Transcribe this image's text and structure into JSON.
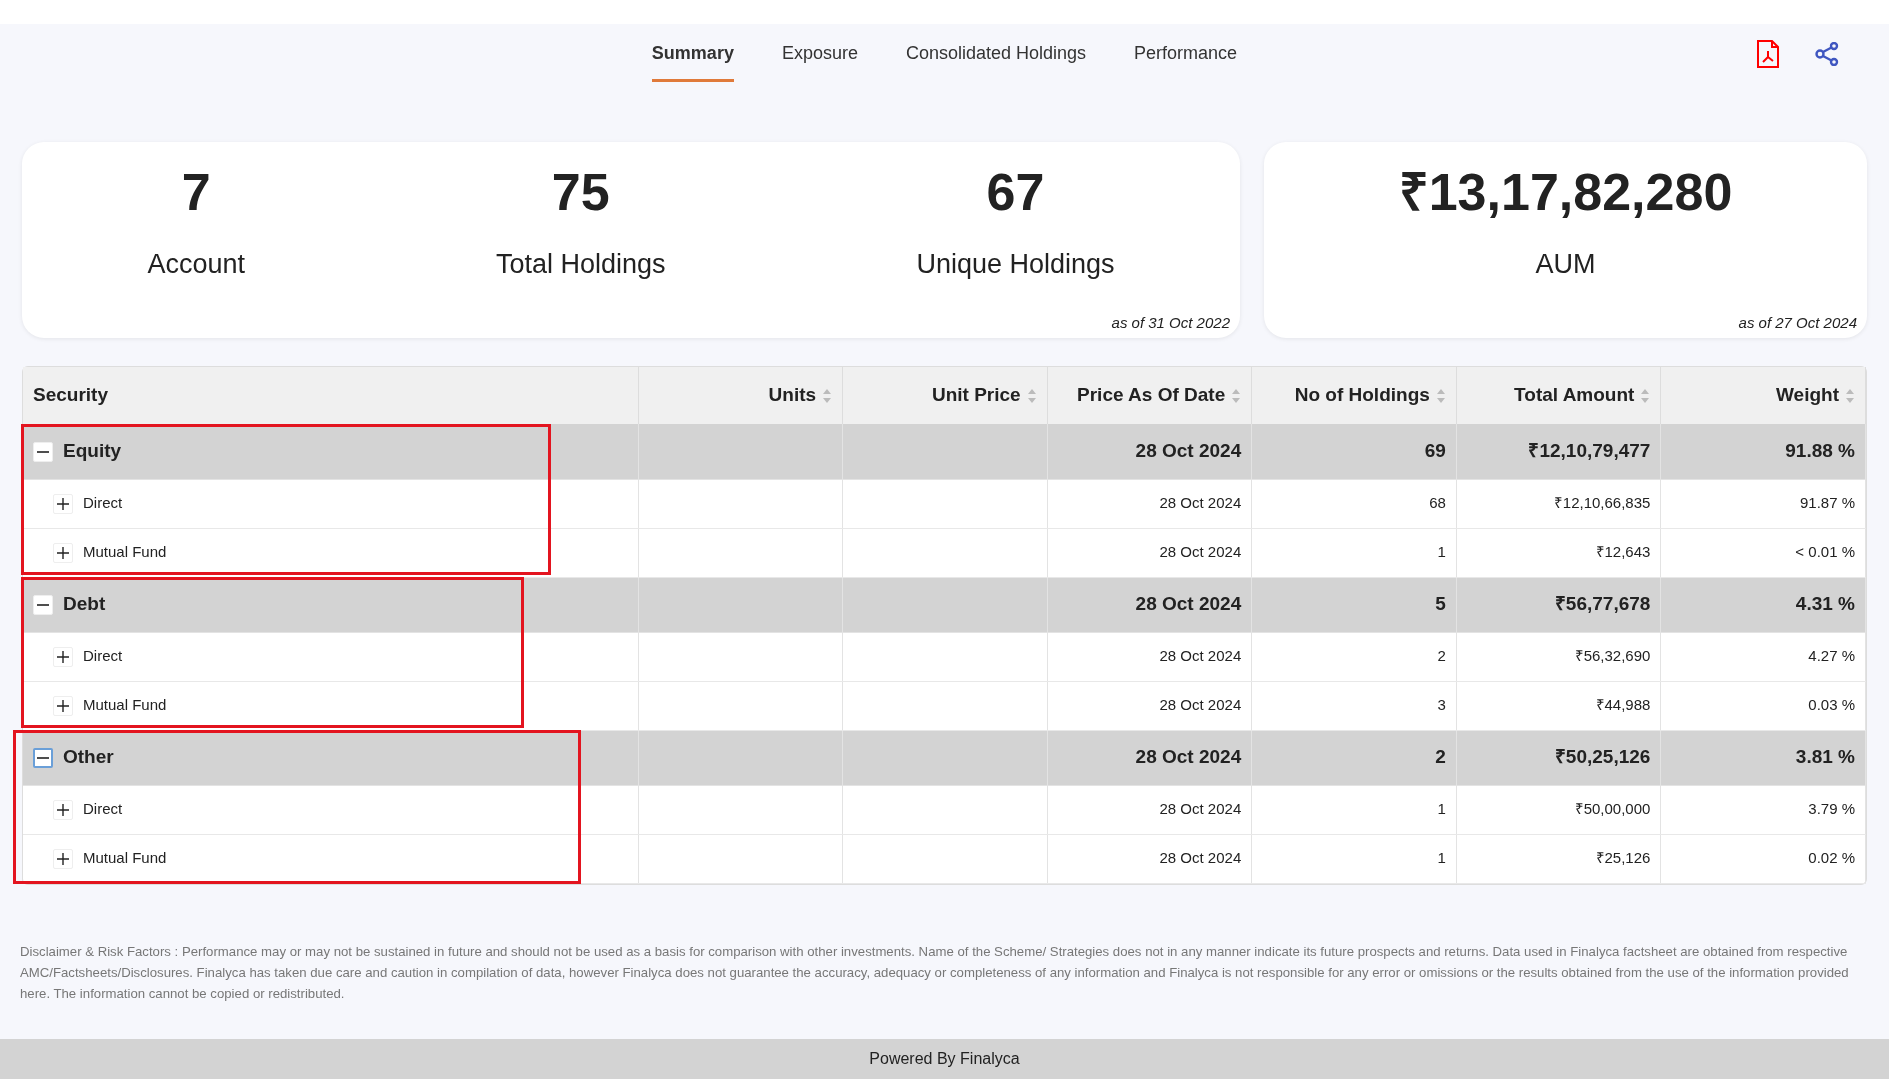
{
  "tabs": [
    {
      "label": "Summary",
      "selected": true
    },
    {
      "label": "Exposure",
      "selected": false
    },
    {
      "label": "Consolidated Holdings",
      "selected": false
    },
    {
      "label": "Performance",
      "selected": false
    }
  ],
  "stats_card": {
    "items": [
      {
        "value": "7",
        "label": "Account"
      },
      {
        "value": "75",
        "label": "Total Holdings"
      },
      {
        "value": "67",
        "label": "Unique Holdings"
      }
    ],
    "as_of": "as of 31 Oct 2022"
  },
  "aum_card": {
    "value": "₹13,17,82,280",
    "label": "AUM",
    "as_of": "as of 27 Oct 2024"
  },
  "table": {
    "columns": [
      {
        "label": "Security",
        "sortable": false
      },
      {
        "label": "Units",
        "sortable": true
      },
      {
        "label": "Unit Price",
        "sortable": true
      },
      {
        "label": "Price As Of Date",
        "sortable": true
      },
      {
        "label": "No of Holdings",
        "sortable": true
      },
      {
        "label": "Total Amount",
        "sortable": true
      },
      {
        "label": "Weight",
        "sortable": true
      }
    ],
    "groups": [
      {
        "name": "Equity",
        "expanded": true,
        "highlighted": true,
        "focused": false,
        "date": "28 Oct 2024",
        "holdings": "69",
        "amount": "₹12,10,79,477",
        "weight": "91.88 %",
        "children": [
          {
            "name": "Direct",
            "expanded": false,
            "date": "28 Oct 2024",
            "holdings": "68",
            "amount": "₹12,10,66,835",
            "weight": "91.87 %"
          },
          {
            "name": "Mutual Fund",
            "expanded": false,
            "date": "28 Oct 2024",
            "holdings": "1",
            "amount": "₹12,643",
            "weight": "< 0.01 %"
          }
        ]
      },
      {
        "name": "Debt",
        "expanded": true,
        "highlighted": true,
        "focused": false,
        "date": "28 Oct 2024",
        "holdings": "5",
        "amount": "₹56,77,678",
        "weight": "4.31 %",
        "children": [
          {
            "name": "Direct",
            "expanded": false,
            "date": "28 Oct 2024",
            "holdings": "2",
            "amount": "₹56,32,690",
            "weight": "4.27 %"
          },
          {
            "name": "Mutual Fund",
            "expanded": false,
            "date": "28 Oct 2024",
            "holdings": "3",
            "amount": "₹44,988",
            "weight": "0.03 %"
          }
        ]
      },
      {
        "name": "Other",
        "expanded": true,
        "highlighted": true,
        "focused": true,
        "date": "28 Oct 2024",
        "holdings": "2",
        "amount": "₹50,25,126",
        "weight": "3.81 %",
        "children": [
          {
            "name": "Direct",
            "expanded": false,
            "date": "28 Oct 2024",
            "holdings": "1",
            "amount": "₹50,00,000",
            "weight": "3.79 %"
          },
          {
            "name": "Mutual Fund",
            "expanded": false,
            "date": "28 Oct 2024",
            "holdings": "1",
            "amount": "₹25,126",
            "weight": "0.02 %"
          }
        ]
      }
    ]
  },
  "disclaimer": "Disclaimer & Risk Factors : Performance may or may not be sustained in future and should not be used as a basis for comparison with other investments. Name of the Scheme/ Strategies does not in any manner indicate its future prospects and returns. Data used in Finalyca factsheet are obtained from respective AMC/Factsheets/Disclosures. Finalyca has taken due care and caution in compilation of data, however Finalyca does not guarantee the accuracy, adequacy or completeness of any information and Finalyca is not responsible for any error or omissions or the results obtained from the use of the information provided here. The information cannot be copied or redistributed.",
  "footer": "Powered By Finalyca"
}
